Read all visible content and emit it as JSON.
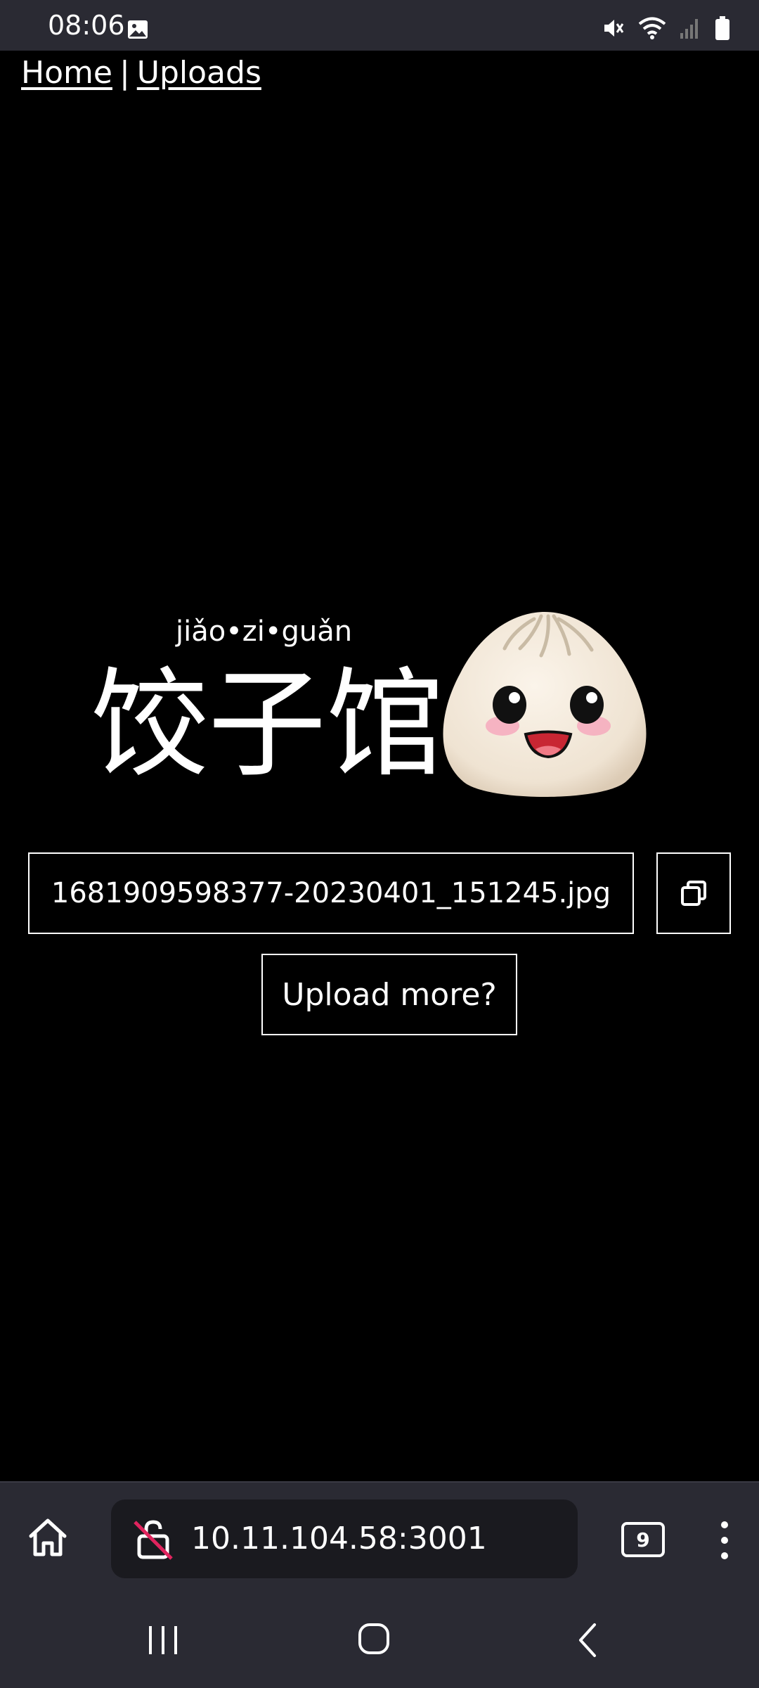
{
  "status_bar": {
    "time": "08:06",
    "icons": [
      "gallery-icon",
      "mute-icon",
      "wifi-icon",
      "signal-icon",
      "battery-icon"
    ]
  },
  "nav": {
    "home_label": "Home",
    "separator": "|",
    "uploads_label": "Uploads"
  },
  "logo": {
    "pinyin": "jiǎo•zi•guǎn",
    "hanzi": "饺子馆",
    "mascot_icon": "bao-bun-icon"
  },
  "upload_result": {
    "filename": "1681909598377-20230401_151245.jpg",
    "copy_icon": "copy-icon",
    "upload_more_label": "Upload more?"
  },
  "browser": {
    "url": "10.11.104.58:3001",
    "tab_count": "9",
    "home_icon": "home-icon",
    "lock_icon": "insecure-lock-icon",
    "menu_icon": "more-vert-icon"
  },
  "android_nav": {
    "icons": [
      "recents-icon",
      "home-circle-icon",
      "back-icon"
    ]
  },
  "colors": {
    "background": "#000000",
    "chrome": "#2a2a33",
    "url_pill": "#1a1a1f",
    "text": "#ffffff"
  }
}
